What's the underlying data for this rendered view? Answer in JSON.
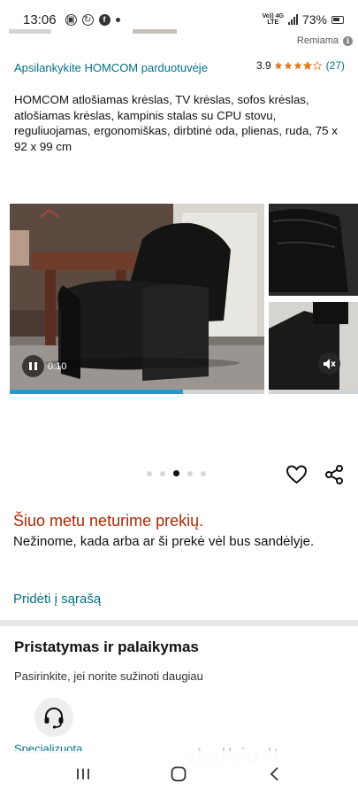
{
  "status_bar": {
    "time": "13:06",
    "network": "Vo)) 4G\nLTE",
    "battery": "73%"
  },
  "sponsored": {
    "label": "Remiama"
  },
  "store": {
    "link": "Apsilankykite HOMCOM parduotuvėje"
  },
  "rating": {
    "value": "3.9",
    "count": "(27)",
    "stars": 3.9
  },
  "product": {
    "title": "HOMCOM atlošiamas krėslas, TV krėslas, sofos krėslas, atlošiamas krėslas, kampinis stalas su CPU stovu, reguliuojamas, ergonomiškas, dirbtinė oda, plienas, ruda, 75 x 92 x 99 cm"
  },
  "video": {
    "time": "0:10",
    "progress": 0.68
  },
  "carousel": {
    "dot_count": 5,
    "active_index": 2
  },
  "availability": {
    "headline": "Šiuo metu neturime prekių.",
    "description": "Nežinome, kada arba ar ši prekė vėl bus sandėlyje.",
    "add_to_list": "Pridėti į sąrašą"
  },
  "delivery": {
    "title": "Pristatymas ir palaikymas",
    "subtitle": "Pasirinkite, jei norite sužinoti daugiau",
    "support_label": "Specializuota"
  },
  "watermark": "skelbiu.lt",
  "colors": {
    "link": "#007185",
    "unavailable": "#b12704",
    "star": "#de7921",
    "progress": "#1aa0c9"
  }
}
